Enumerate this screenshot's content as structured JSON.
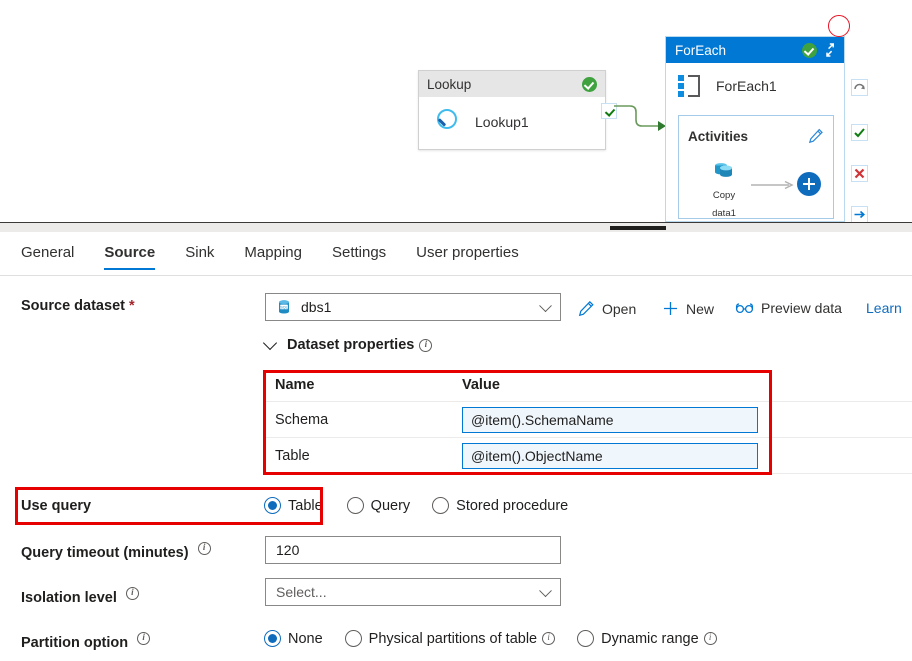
{
  "canvas": {
    "lookup_activity": {
      "type_label": "Lookup",
      "name": "Lookup1",
      "status_icon": "green-check-icon",
      "activity_icon": "magnifier-icon"
    },
    "connector": {
      "badge_icon": "check-icon",
      "arrow_icon": "arrow-right-icon"
    },
    "foreach_activity": {
      "type_label": "ForEach",
      "name": "ForEach1",
      "status_icon": "green-check-icon",
      "expand_icon": "expand-collapse-icon",
      "activity_icon": "foreach-icon",
      "inner": {
        "section_label": "Activities",
        "edit_icon": "pencil-icon",
        "child_activity_label": "Copy\ndata1",
        "child_activity_icon": "copy-data-icon",
        "arrow_icon": "arrow-right-icon",
        "add_icon": "plus-circle-icon"
      }
    },
    "side_toolbar": [
      {
        "icon": "rerun-icon"
      },
      {
        "icon": "success-check-icon"
      },
      {
        "icon": "failure-x-icon"
      },
      {
        "icon": "skipped-arrow-icon"
      }
    ],
    "annotation_circle": {
      "icon": "red-circle-annotation",
      "color": "#e60000"
    }
  },
  "splitter": {
    "grip_icon": "drag-handle-icon"
  },
  "panel": {
    "tabs": [
      {
        "label": "General",
        "active": false
      },
      {
        "label": "Source",
        "active": true
      },
      {
        "label": "Sink",
        "active": false
      },
      {
        "label": "Mapping",
        "active": false
      },
      {
        "label": "Settings",
        "active": false
      },
      {
        "label": "User properties",
        "active": false
      }
    ],
    "source_dataset": {
      "label": "Source dataset",
      "required_marker": "*",
      "value": "dbs1",
      "value_icon": "sql-database-icon",
      "chevron_icon": "chevron-down-icon",
      "actions": [
        {
          "label": "Open",
          "icon": "pencil-icon"
        },
        {
          "label": "New",
          "icon": "plus-icon"
        },
        {
          "label": "Preview data",
          "icon": "glasses-icon"
        }
      ],
      "learn_link": "Learn"
    },
    "dataset_properties": {
      "heading": "Dataset properties",
      "caret_icon": "chevron-down-icon",
      "info_icon": "info-icon",
      "columns": [
        "Name",
        "Value"
      ],
      "rows": [
        {
          "name": "Schema",
          "value": "@item().SchemaName"
        },
        {
          "name": "Table",
          "value": "@item().ObjectName"
        }
      ]
    },
    "use_query": {
      "label": "Use query",
      "options": [
        {
          "label": "Table",
          "selected": true
        },
        {
          "label": "Query",
          "selected": false
        },
        {
          "label": "Stored procedure",
          "selected": false
        }
      ]
    },
    "query_timeout": {
      "label": "Query timeout (minutes)",
      "info_icon": "info-icon",
      "value": "120"
    },
    "isolation_level": {
      "label": "Isolation level",
      "info_icon": "info-icon",
      "placeholder": "Select...",
      "value": "Select...",
      "chevron_icon": "chevron-down-icon"
    },
    "partition_option": {
      "label": "Partition option",
      "info_icon": "info-icon",
      "options": [
        {
          "label": "None",
          "selected": true,
          "has_info": false
        },
        {
          "label": "Physical partitions of table",
          "selected": false,
          "has_info": true
        },
        {
          "label": "Dynamic range",
          "selected": false,
          "has_info": true
        }
      ]
    }
  },
  "annotations": {
    "highlight_color": "#e60000",
    "boxes": [
      {
        "name": "dataset-properties-table-highlight"
      },
      {
        "name": "use-query-row-highlight"
      },
      {
        "name": "foreach-maximize-highlight"
      }
    ]
  },
  "colors": {
    "accent": "#0078d4",
    "link": "#0f6cbd",
    "success": "#3fa23f",
    "error": "#e81123",
    "annotation": "#e60000",
    "field_border": "#8a8886",
    "input_focus_bg": "#eff6fc"
  }
}
